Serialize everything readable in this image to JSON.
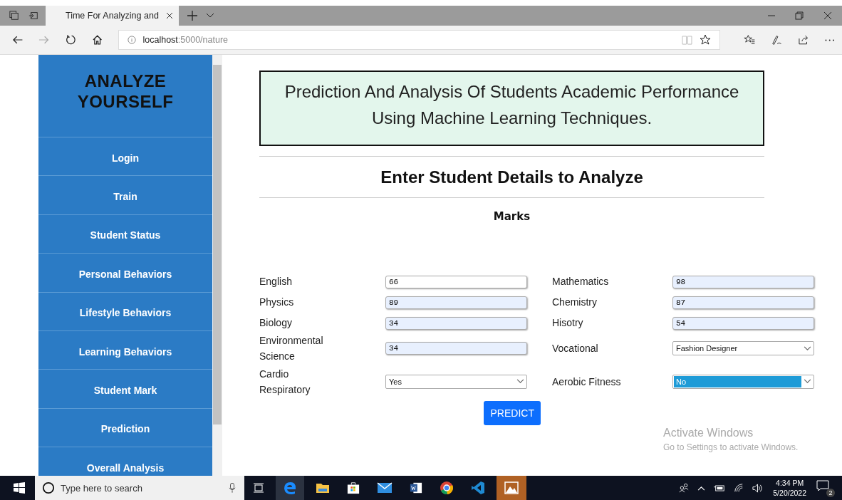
{
  "browser": {
    "tab_title": "Time For Analyzing and",
    "url_host": "localhost",
    "url_path": ":5000/nature"
  },
  "sidebar": {
    "title": "ANALYZE YOURSELF",
    "items": [
      {
        "label": "Login"
      },
      {
        "label": "Train"
      },
      {
        "label": "Student Status"
      },
      {
        "label": "Personal Behaviors"
      },
      {
        "label": "Lifestyle Behaviors"
      },
      {
        "label": "Learning Behaviors"
      },
      {
        "label": "Student Mark"
      },
      {
        "label": "Prediction"
      },
      {
        "label": "Overall Analysis"
      }
    ]
  },
  "banner": [
    "Prediction And Analysis Of Students Academic Performance",
    "Using Machine Learning Techniques."
  ],
  "heading": "Enter Student Details to Analyze",
  "section": "Marks",
  "fields": [
    {
      "kind": "input",
      "label": "English",
      "value": "66",
      "highlighted": false
    },
    {
      "kind": "input",
      "label": "Mathematics",
      "value": "98",
      "highlighted": true
    },
    {
      "kind": "input",
      "label": "Physics",
      "value": "89",
      "highlighted": true
    },
    {
      "kind": "input",
      "label": "Chemistry",
      "value": "87",
      "highlighted": true
    },
    {
      "kind": "input",
      "label": "Biology",
      "value": "34",
      "highlighted": true
    },
    {
      "kind": "input",
      "label": "Hisotry",
      "value": "54",
      "highlighted": true
    },
    {
      "kind": "input",
      "label": "Environmental Science",
      "value": "34",
      "highlighted": true
    },
    {
      "kind": "select",
      "label": "Vocational",
      "value": "Fashion Designer",
      "highlighted": false
    },
    {
      "kind": "select",
      "label": "Cardio Respiratory",
      "value": "Yes",
      "highlighted": false
    },
    {
      "kind": "select",
      "label": "Aerobic Fitness",
      "value": "No",
      "highlighted": true
    }
  ],
  "button": "PREDICT",
  "activation": {
    "title": "Activate Windows",
    "text": "Go to Settings to activate Windows."
  },
  "taskbar": {
    "search_placeholder": "Type here to search",
    "time": "4:34 PM",
    "date": "5/20/2022",
    "notifications": "2"
  }
}
